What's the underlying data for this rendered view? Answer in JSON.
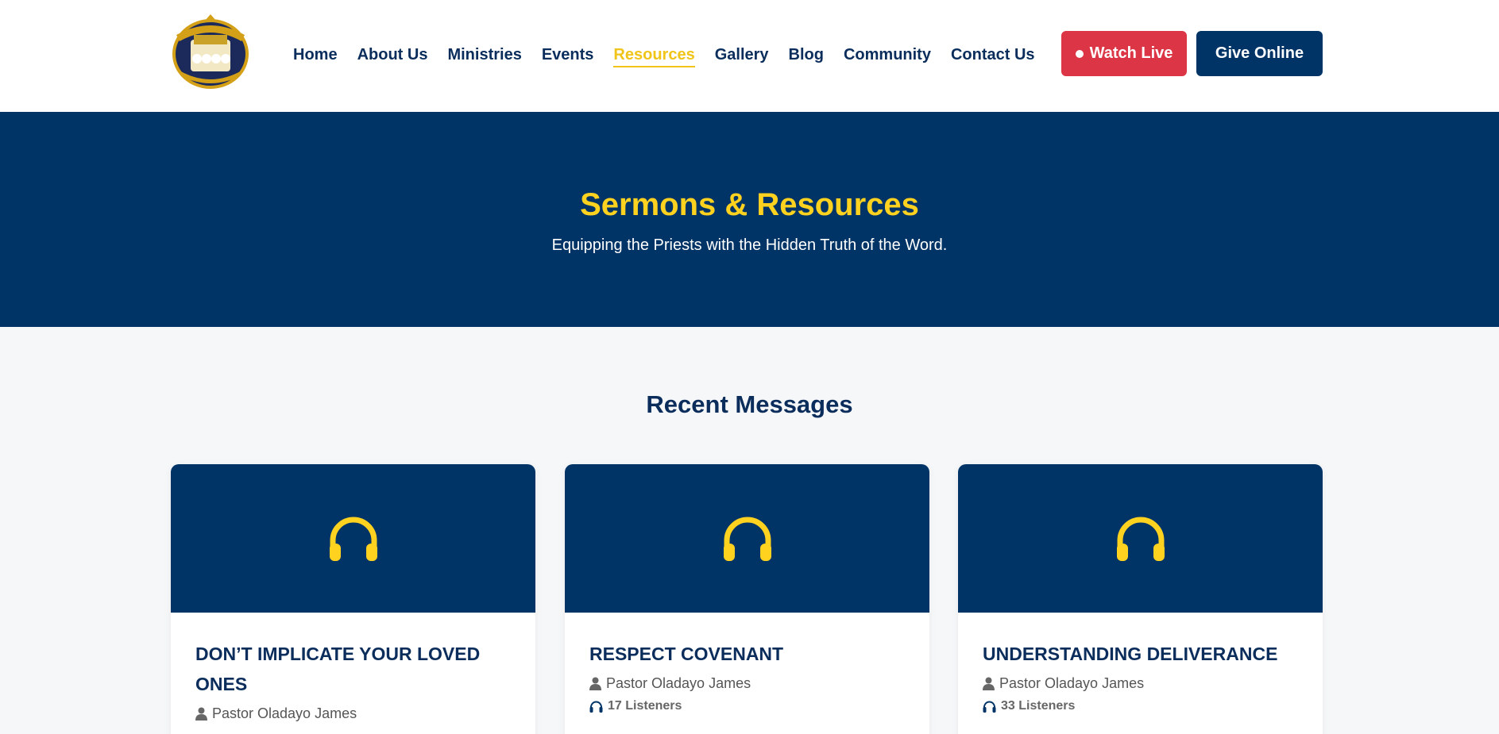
{
  "logo": {
    "alt": "Kingdom of God's Priests International Ministries"
  },
  "nav": {
    "items": [
      "Home",
      "About Us",
      "Ministries",
      "Events",
      "Resources",
      "Gallery",
      "Blog",
      "Community",
      "Contact Us"
    ],
    "active": "Resources"
  },
  "header": {
    "watch_live": "Watch Live",
    "give_online": "Give Online"
  },
  "hero": {
    "title": "Sermons & Resources",
    "subtitle": "Equipping the Priests with the Hidden Truth of the Word."
  },
  "section": {
    "title": "Recent Messages"
  },
  "cards": [
    {
      "title": "DON’T IMPLICATE YOUR LOVED ONES",
      "author": "Pastor Oladayo James",
      "listeners": ""
    },
    {
      "title": "RESPECT COVENANT",
      "author": "Pastor Oladayo James",
      "listeners": "17 Listeners"
    },
    {
      "title": "UNDERSTANDING DELIVERANCE",
      "author": "Pastor Oladayo James",
      "listeners": "33 Listeners"
    }
  ],
  "colors": {
    "navy": "#003366",
    "gold": "#ffd21f",
    "red": "#dc3545"
  },
  "icons": {
    "thumb": "headphones-icon",
    "author": "user-icon",
    "listeners": "headphones-icon"
  }
}
